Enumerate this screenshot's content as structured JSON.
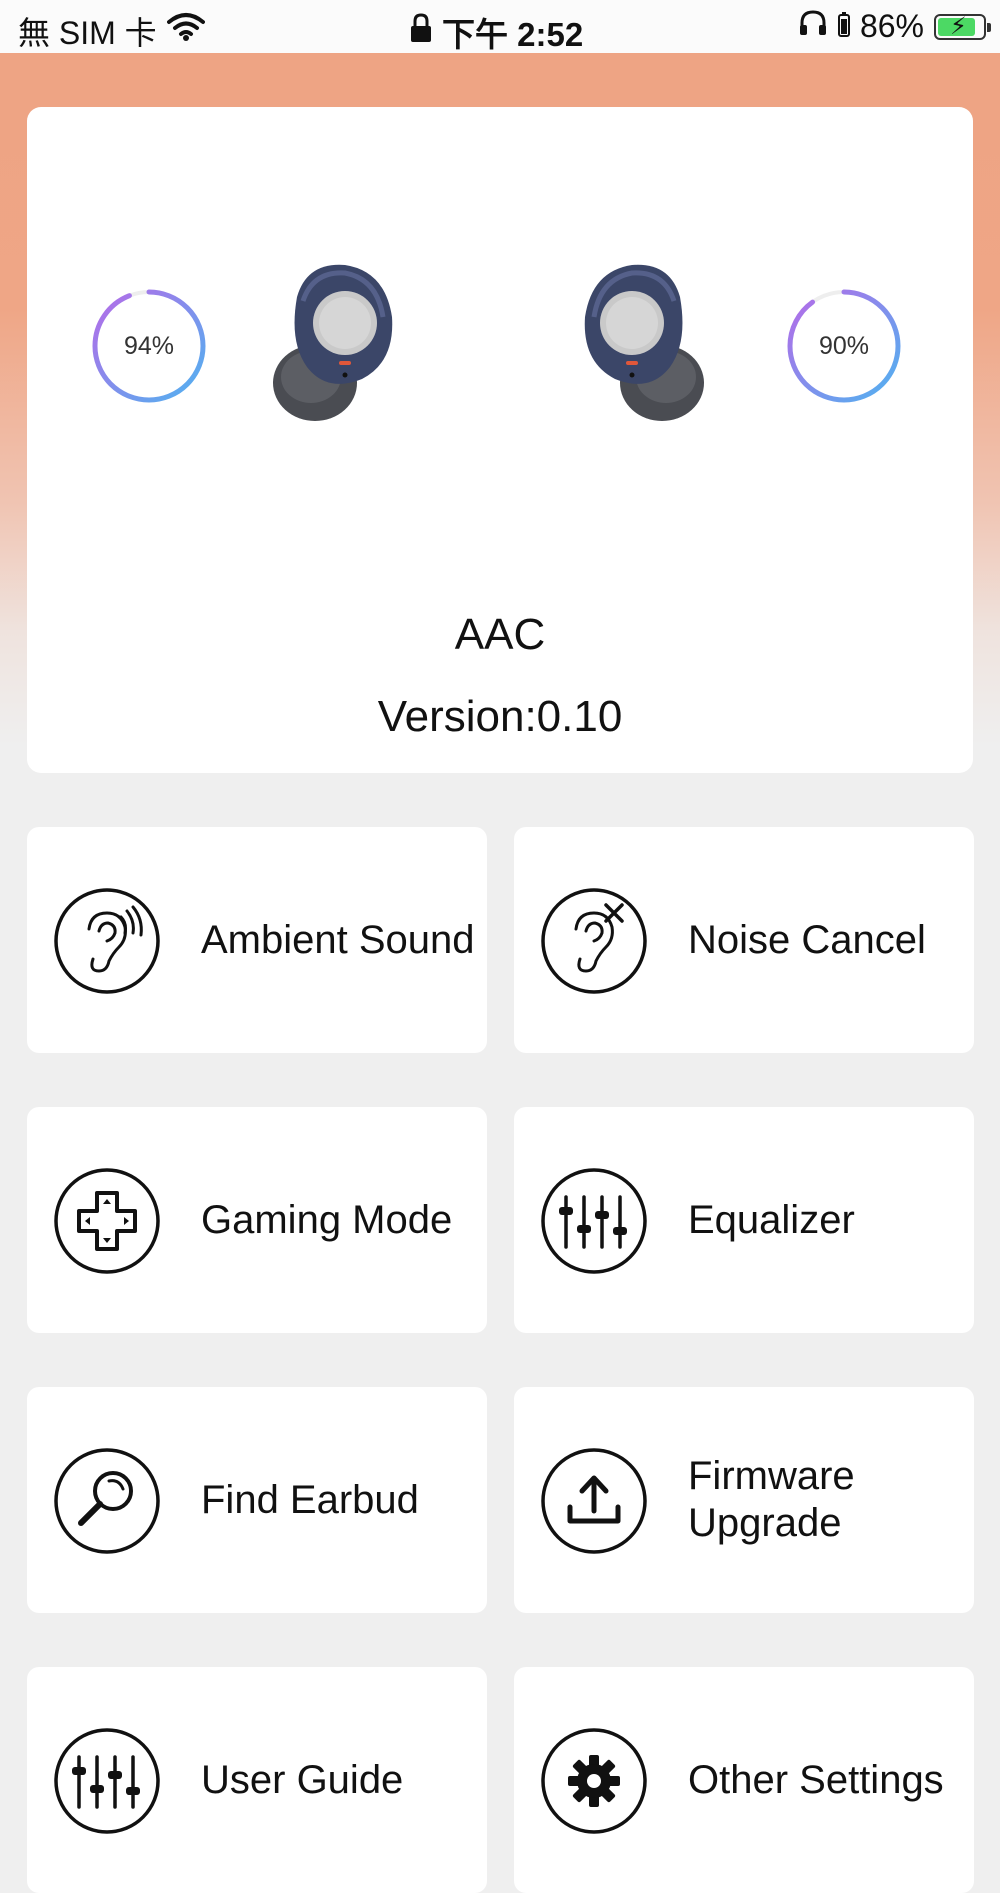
{
  "status_bar": {
    "carrier": "無 SIM 卡",
    "time": "下午 2:52",
    "battery_percent": "86%",
    "battery_level": 0.86
  },
  "device": {
    "left_battery": "94%",
    "left_level": 0.94,
    "right_battery": "90%",
    "right_level": 0.9,
    "codec": "AAC",
    "version": "Version:0.10"
  },
  "tiles": [
    {
      "label": "Ambient Sound",
      "icon": "ear-waves-icon"
    },
    {
      "label": "Noise Cancel",
      "icon": "ear-mute-icon"
    },
    {
      "label": "Gaming Mode",
      "icon": "gamepad-dpad-icon"
    },
    {
      "label": "Equalizer",
      "icon": "equalizer-sliders-icon"
    },
    {
      "label": "Find Earbud",
      "icon": "magnifier-icon"
    },
    {
      "label": "Firmware\nUpgrade",
      "icon": "upload-icon"
    },
    {
      "label": "User Guide",
      "icon": "guide-sliders-icon"
    },
    {
      "label": "Other Settings",
      "icon": "gear-icon"
    }
  ],
  "colors": {
    "header_gradient_top": "#eea383",
    "ring_start": "#4fb3f0",
    "ring_end": "#b76ae8",
    "background": "#efefef"
  }
}
